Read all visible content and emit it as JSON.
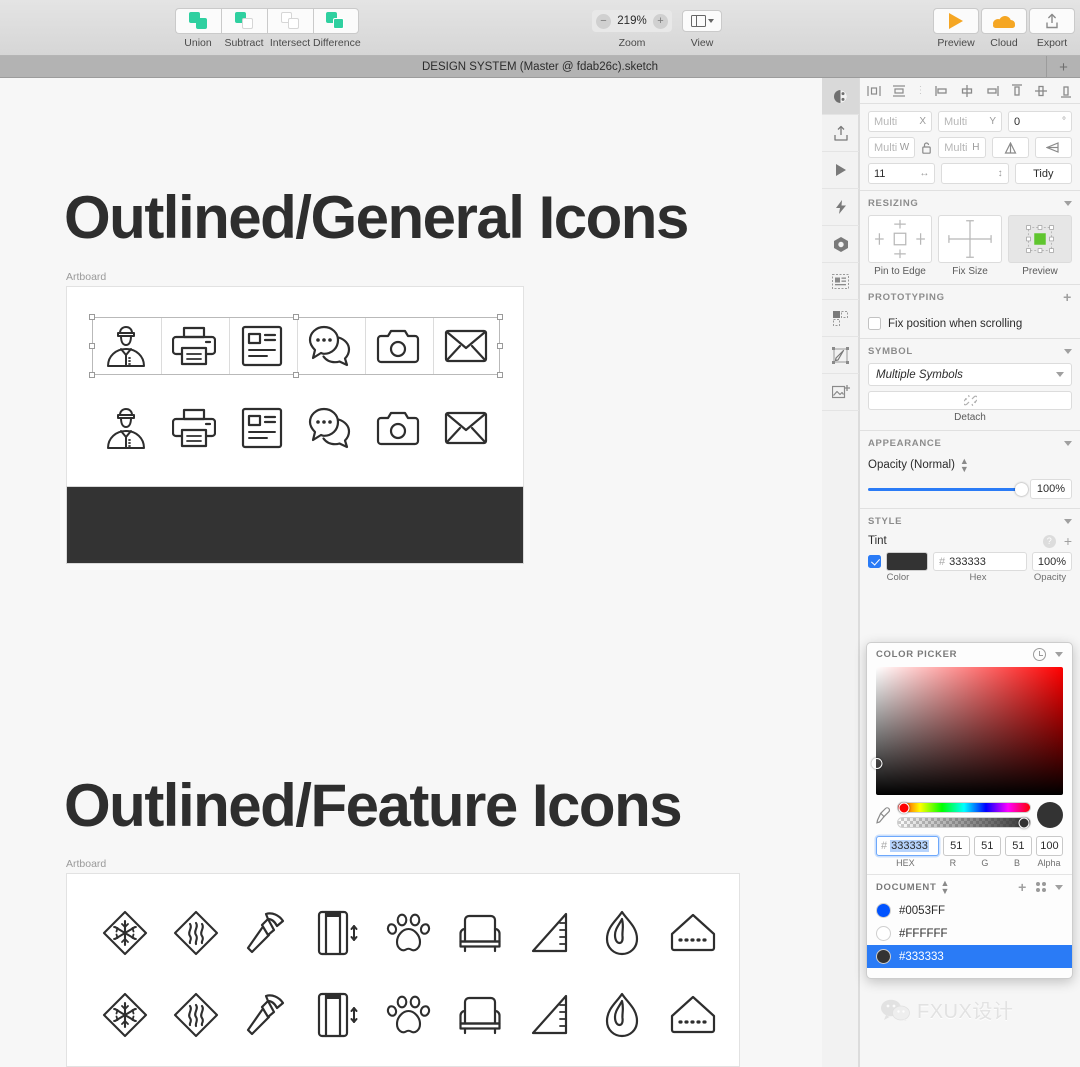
{
  "toolbar": {
    "boolean_ops": [
      {
        "label": "Union",
        "icon": "union-icon"
      },
      {
        "label": "Subtract",
        "icon": "subtract-icon"
      },
      {
        "label": "Intersect",
        "icon": "intersect-icon"
      },
      {
        "label": "Difference",
        "icon": "difference-icon"
      }
    ],
    "zoom": {
      "value": "219%",
      "label": "Zoom",
      "minus": "−",
      "plus": "+"
    },
    "view": {
      "label": "View",
      "icon": "layout-panes-icon"
    },
    "actions": [
      {
        "label": "Preview",
        "icon": "play-icon"
      },
      {
        "label": "Cloud",
        "icon": "cloud-icon"
      },
      {
        "label": "Export",
        "icon": "export-icon"
      }
    ]
  },
  "titlebar": {
    "document": "DESIGN SYSTEM  (Master @ fdab26c).sketch",
    "new_tab": "+"
  },
  "canvas": {
    "sections": [
      {
        "heading": "Outlined/General Icons",
        "artboard_label": "Artboard",
        "icons": [
          "police-officer",
          "printer",
          "id-card",
          "chat-bubbles",
          "camera",
          "envelope"
        ]
      },
      {
        "heading": "Outlined/Feature Icons",
        "artboard_label": "Artboard",
        "icons": [
          "snowflake",
          "heat-waves",
          "hammer",
          "door-height",
          "paw-print",
          "armchair",
          "ruler-triangle",
          "flame",
          "house-vent"
        ]
      }
    ]
  },
  "rail": {
    "items": [
      {
        "name": "inspector-icon",
        "active": true
      },
      {
        "name": "export-upload-icon",
        "active": false
      },
      {
        "name": "prototype-play-icon",
        "active": false
      },
      {
        "name": "flash-icon",
        "active": false
      },
      {
        "name": "component-hex-icon",
        "active": false
      },
      {
        "name": "layout-grid-icon",
        "active": false
      },
      {
        "name": "selection-squares-icon",
        "active": false
      },
      {
        "name": "edit-shape-icon",
        "active": false
      },
      {
        "name": "insert-image-icon",
        "active": false
      }
    ]
  },
  "inspector": {
    "align_icons": [
      "align-left-icon",
      "distribute-vertical-icon",
      "more-icon",
      "align-horizontal-left-icon",
      "align-horizontal-center-icon",
      "align-horizontal-right-icon",
      "align-vertical-top-icon",
      "align-vertical-middle-icon",
      "align-vertical-bottom-icon"
    ],
    "geometry": {
      "x": {
        "value": "Multi",
        "unit": "X"
      },
      "y": {
        "value": "Multi",
        "unit": "Y"
      },
      "rotation": {
        "value": "0",
        "unit": "°"
      },
      "w": {
        "value": "Multi",
        "unit": "W"
      },
      "h": {
        "value": "Multi",
        "unit": "H"
      },
      "radius": {
        "value": "11",
        "unit": "↔"
      },
      "spacing": {
        "value": "",
        "unit": "↕"
      },
      "tidy": "Tidy",
      "flip_horizontal": "flip-horizontal-icon",
      "flip_vertical": "flip-vertical-icon",
      "lock": "lock-icon"
    },
    "resizing": {
      "title": "RESIZING",
      "cards": [
        {
          "caption": "Pin to Edge",
          "selected": false
        },
        {
          "caption": "Fix Size",
          "selected": false
        },
        {
          "caption": "Preview",
          "selected": true
        }
      ]
    },
    "prototyping": {
      "title": "PROTOTYPING",
      "add": "+",
      "fix_position": {
        "label": "Fix position when scrolling",
        "checked": false
      }
    },
    "symbol": {
      "title": "SYMBOL",
      "selected": "Multiple Symbols",
      "detach_caption": "Detach",
      "detach_icon": "broken-link-icon"
    },
    "appearance": {
      "title": "APPEARANCE",
      "opacity_label": "Opacity (Normal)",
      "opacity_value": "100%",
      "opacity_percent": 100
    },
    "style": {
      "title": "STYLE",
      "tint_label": "Tint",
      "help": "?",
      "add": "+",
      "enabled": true,
      "color": "#333333",
      "hex_prefix": "#",
      "hex": "333333",
      "opacity": "100%",
      "captions": [
        "Color",
        "Hex",
        "Opacity"
      ]
    }
  },
  "color_picker": {
    "title": "COLOR PICKER",
    "history_icon": "clock-icon",
    "collapse_icon": "chevron-down-icon",
    "eyedropper_icon": "eyedropper-icon",
    "preview_color": "#333333",
    "fields": {
      "hex_prefix": "#",
      "hex": "333333",
      "r": "51",
      "g": "51",
      "b": "51",
      "alpha": "100"
    },
    "captions": [
      "HEX",
      "R",
      "G",
      "B",
      "Alpha"
    ],
    "document": {
      "title": "DOCUMENT",
      "add": "+",
      "grid_icon": "grid-view-icon",
      "chevron_icon": "chevron-down-icon",
      "swatches": [
        {
          "hex": "#0053FF",
          "label": "#0053FF",
          "selected": false
        },
        {
          "hex": "#FFFFFF",
          "label": "#FFFFFF",
          "selected": false
        },
        {
          "hex": "#333333",
          "label": "#333333",
          "selected": true
        }
      ]
    }
  },
  "watermark": {
    "text": "FXUX设计",
    "icon": "wechat-icon"
  },
  "colors": {
    "accent_blue": "#2a7bf6",
    "tint": "#333333",
    "green": "#2fd0a0",
    "orange": "#f5a623"
  }
}
